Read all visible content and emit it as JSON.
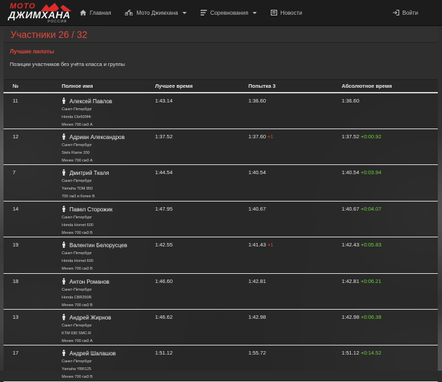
{
  "brand": {
    "top": "МОТО",
    "main": "ДЖИМХАНА",
    "sub": "РОССИЯ"
  },
  "nav": {
    "home": "Главная",
    "moto": "Мото Джимхана",
    "competitions": "Соревнования",
    "news": "Новости",
    "login": "Войти"
  },
  "page": {
    "title": "Участники 26 / 32",
    "section_title": "Лучшие пилоты",
    "section_desc": "Позиции участников без учёта класса и группы"
  },
  "table": {
    "headers": {
      "num": "№",
      "name": "Полное имя",
      "best": "Лучшее время",
      "attempt": "Попытка 3",
      "absolute": "Абсолютное время"
    },
    "rows": [
      {
        "num": "11",
        "name": "Алексей Павлов",
        "city": "Санкт-Петербург",
        "bike": "Honda Cbr600f4i",
        "class": "Менее 700 см3 A",
        "best": "1:43.14",
        "attempt": "1:36.60",
        "attempt_pen": "",
        "abs": "1:36.60",
        "abs_diff": ""
      },
      {
        "num": "12",
        "name": "Адриан Александров",
        "city": "Санкт-Петербург",
        "bike": "Stels Flame 200",
        "class": "Менее 700 см3 A",
        "best": "1:37.52",
        "attempt": "1:37.60",
        "attempt_pen": "+1",
        "abs": "1:37.52",
        "abs_diff": "+0:00.92"
      },
      {
        "num": "7",
        "name": "Дмитрий Ткаля",
        "city": "Санкт-Петербург",
        "bike": "Yamaha TDM 850",
        "class": "700 см3 и более B",
        "best": "1:44.54",
        "attempt": "1:40.54",
        "attempt_pen": "",
        "abs": "1:40.54",
        "abs_diff": "+0:03.94"
      },
      {
        "num": "14",
        "name": "Павел Сторожик",
        "city": "Санкт-Петербург",
        "bike": "Honda Hornet 600",
        "class": "Менее 700 см3 B",
        "best": "1:47.95",
        "attempt": "1:40.67",
        "attempt_pen": "",
        "abs": "1:40.67",
        "abs_diff": "+0:04.07"
      },
      {
        "num": "19",
        "name": "Валентин Белорусцев",
        "city": "Санкт-Петербург",
        "bike": "Honda Hornet 600",
        "class": "Менее 700 см3 B",
        "best": "1:42.55",
        "attempt": "1:41.43",
        "attempt_pen": "+1",
        "abs": "1:42.43",
        "abs_diff": "+0:05.83"
      },
      {
        "num": "18",
        "name": "Антон Романов",
        "city": "Санкт-Петербург",
        "bike": "Honda CBR250R",
        "class": "Менее 700 см3 B",
        "best": "1:46.60",
        "attempt": "1:42.81",
        "attempt_pen": "",
        "abs": "1:42.81",
        "abs_diff": "+0:06.21"
      },
      {
        "num": "13",
        "name": "Андрей Жирнов",
        "city": "Санкт-Петербург",
        "bike": "KTM 690 SMC-R",
        "class": "Менее 700 см3 A",
        "best": "1:46.62",
        "attempt": "1:42.98",
        "attempt_pen": "",
        "abs": "1:42.98",
        "abs_diff": "+0:06.38"
      },
      {
        "num": "17",
        "name": "Андрей Шалашов",
        "city": "Санкт-Петербург",
        "bike": "Yamaha YBR125",
        "class": "Менее 700 см3 B",
        "best": "1:51.12",
        "attempt": "1:55.72",
        "attempt_pen": "",
        "abs": "1:51.12",
        "abs_diff": "+0:14.52"
      }
    ]
  },
  "colors": {
    "accent": "#e24a3b",
    "positive": "#6ccf3a",
    "navbar": "#1c1c1c"
  }
}
